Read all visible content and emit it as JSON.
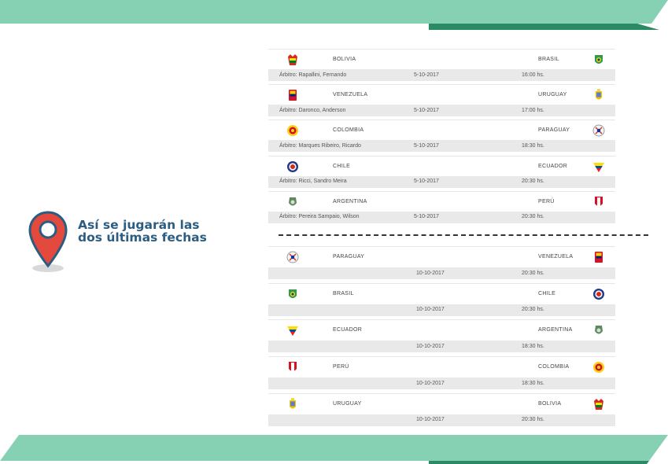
{
  "headline": [
    "Así se jugarán las",
    "dos últimas fechas"
  ],
  "colors": {
    "banner_light": "#86d1b4",
    "banner_dark": "#2a8a66",
    "pin": "#e4493d",
    "pin_ring": "#2b5d82",
    "headline": "#2b5d82"
  },
  "round1": [
    {
      "home": "BOLIVIA",
      "away": "BRASIL",
      "home_flag": "bolivia-flag-icon",
      "away_flag": "brazil-flag-icon",
      "referee": "Árbitro: Rapallini, Fernando",
      "date": "5-10-2017",
      "time": "16:00 hs."
    },
    {
      "home": "VENEZUELA",
      "away": "URUGUAY",
      "home_flag": "venezuela-flag-icon",
      "away_flag": "uruguay-flag-icon",
      "referee": "Árbitro: Daronco, Anderson",
      "date": "5-10-2017",
      "time": "17:00 hs."
    },
    {
      "home": "COLOMBIA",
      "away": "PARAGUAY",
      "home_flag": "colombia-flag-icon",
      "away_flag": "paraguay-flag-icon",
      "referee": "Árbitro: Marques Ribeiro, Ricardo",
      "date": "5-10-2017",
      "time": "18:30 hs."
    },
    {
      "home": "CHILE",
      "away": "ECUADOR",
      "home_flag": "chile-flag-icon",
      "away_flag": "ecuador-flag-icon",
      "referee": "Árbitro: Ricci, Sandro Meira",
      "date": "5-10-2017",
      "time": "20:30 hs."
    },
    {
      "home": "ARGENTINA",
      "away": "PERÚ",
      "home_flag": "argentina-flag-icon",
      "away_flag": "peru-flag-icon",
      "referee": "Árbitro: Pereira Sampaio, Wilson",
      "date": "5-10-2017",
      "time": "20:30 hs."
    }
  ],
  "round2": [
    {
      "home": "PARAGUAY",
      "away": "VENEZUELA",
      "home_flag": "paraguay-flag-icon",
      "away_flag": "venezuela-flag-icon",
      "date": "10-10-2017",
      "time": "20:30 hs."
    },
    {
      "home": "BRASIL",
      "away": "CHILE",
      "home_flag": "brazil-flag-icon",
      "away_flag": "chile-flag-icon",
      "date": "10-10-2017",
      "time": "20:30 hs."
    },
    {
      "home": "ECUADOR",
      "away": "ARGENTINA",
      "home_flag": "ecuador-flag-icon",
      "away_flag": "argentina-flag-icon",
      "date": "10-10-2017",
      "time": "18:30 hs."
    },
    {
      "home": "PERÚ",
      "away": "COLOMBIA",
      "home_flag": "peru-flag-icon",
      "away_flag": "colombia-flag-icon",
      "date": "10-10-2017",
      "time": "18:30 hs."
    },
    {
      "home": "URUGUAY",
      "away": "BOLIVIA",
      "home_flag": "uruguay-flag-icon",
      "away_flag": "bolivia-flag-icon",
      "date": "10-10-2017",
      "time": "20:30 hs."
    }
  ]
}
